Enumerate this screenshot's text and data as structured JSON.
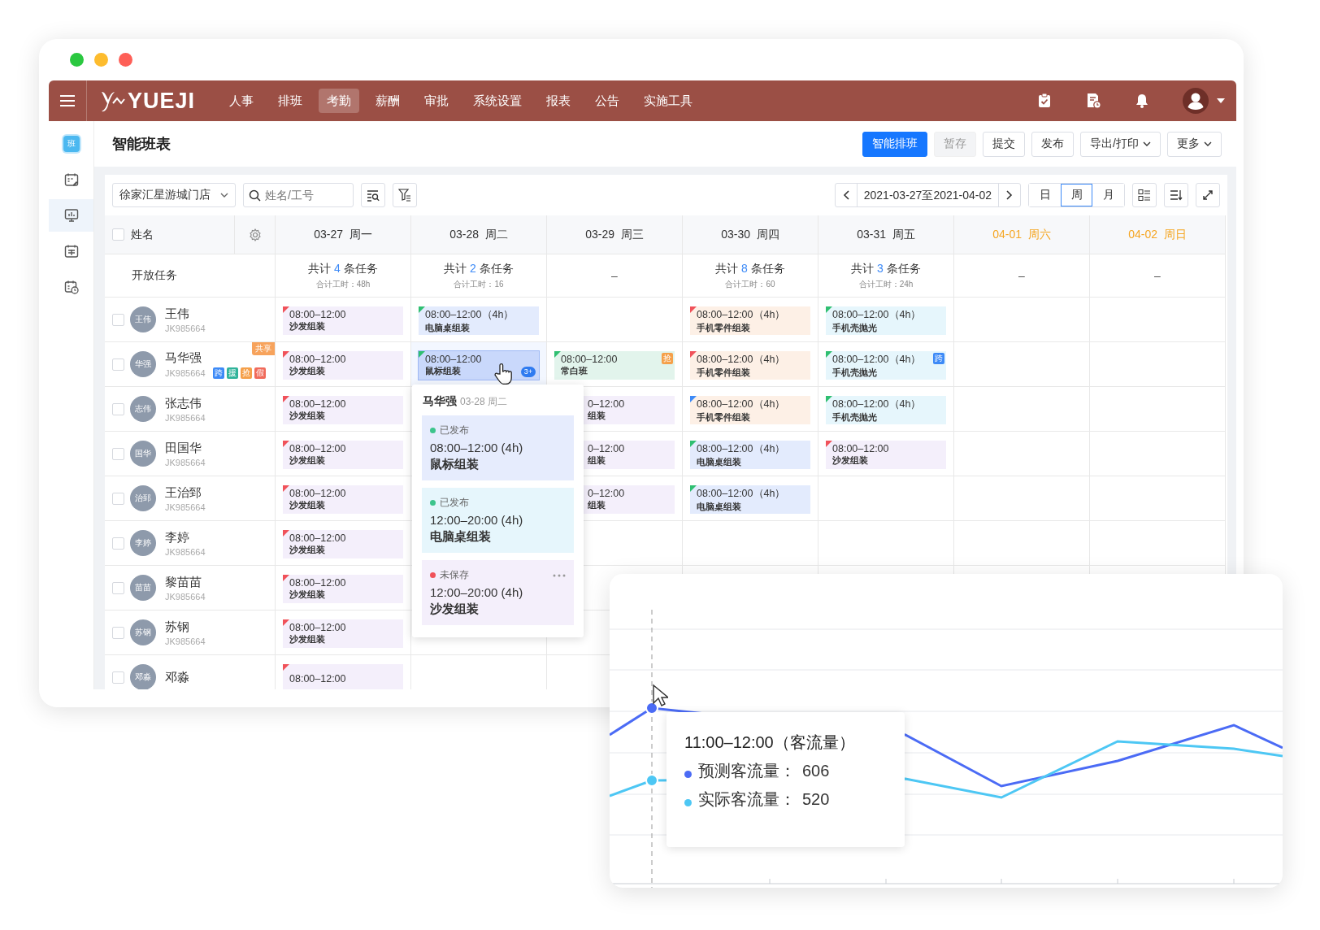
{
  "window_controls": [
    {
      "color": "#2bc840"
    },
    {
      "color": "#fdbc2e"
    },
    {
      "color": "#fe5f57"
    }
  ],
  "nav": {
    "logo": "YUEJI",
    "items": [
      {
        "label": "人事",
        "selected": false
      },
      {
        "label": "排班",
        "selected": false
      },
      {
        "label": "考勤",
        "selected": true
      },
      {
        "label": "薪酬",
        "selected": false
      },
      {
        "label": "审批",
        "selected": false
      },
      {
        "label": "系统设置",
        "selected": false
      },
      {
        "label": "报表",
        "selected": false
      },
      {
        "label": "公告",
        "selected": false
      },
      {
        "label": "实施工具",
        "selected": false
      }
    ]
  },
  "sidebar": [
    {
      "kind": "schedule",
      "text": "班",
      "selected": false
    },
    {
      "kind": "calendar-edit",
      "selected": false
    },
    {
      "kind": "monitor",
      "selected": true
    },
    {
      "kind": "calendar-grid",
      "selected": false
    },
    {
      "kind": "calendar-clock",
      "selected": false
    }
  ],
  "page": {
    "title": "智能班表",
    "actions": [
      {
        "label": "智能排班",
        "kind": "primary",
        "disabled": false,
        "dropdown": false
      },
      {
        "label": "暂存",
        "kind": "default",
        "disabled": true,
        "dropdown": false
      },
      {
        "label": "提交",
        "kind": "default",
        "disabled": false,
        "dropdown": false
      },
      {
        "label": "发布",
        "kind": "default",
        "disabled": false,
        "dropdown": false
      },
      {
        "label": "导出/打印",
        "kind": "default",
        "disabled": false,
        "dropdown": true
      },
      {
        "label": "更多",
        "kind": "default",
        "disabled": false,
        "dropdown": true
      }
    ]
  },
  "filters": {
    "store": "徐家汇星游城门店",
    "search": {
      "placeholder": "姓名/工号"
    },
    "date_range": "2021-03-27至2021-04-02",
    "views": [
      {
        "label": "日",
        "selected": false
      },
      {
        "label": "周",
        "selected": true
      },
      {
        "label": "月",
        "selected": false
      }
    ]
  },
  "table": {
    "name_header": "姓名",
    "all_checked": false,
    "open_label": "开放任务",
    "days": [
      {
        "date": "03-27",
        "weekday": "周一",
        "weekend": false,
        "summary": {
          "kind": "count",
          "prefix": "共计",
          "count": "4",
          "suffix": "条任务",
          "hours": "合计工时：48h"
        }
      },
      {
        "date": "03-28",
        "weekday": "周二",
        "weekend": false,
        "summary": {
          "kind": "count",
          "prefix": "共计",
          "count": "2",
          "suffix": "条任务",
          "hours": "合计工时：16"
        }
      },
      {
        "date": "03-29",
        "weekday": "周三",
        "weekend": false,
        "summary": {
          "kind": "none",
          "text": "–"
        }
      },
      {
        "date": "03-30",
        "weekday": "周四",
        "weekend": false,
        "summary": {
          "kind": "count",
          "prefix": "共计",
          "count": "8",
          "suffix": "条任务",
          "hours": "合计工时：60"
        }
      },
      {
        "date": "03-31",
        "weekday": "周五",
        "weekend": false,
        "summary": {
          "kind": "count",
          "prefix": "共计",
          "count": "3",
          "suffix": "条任务",
          "hours": "合计工时：24h"
        }
      },
      {
        "date": "04-01",
        "weekday": "周六",
        "weekend": true,
        "summary": {
          "kind": "none",
          "text": "–"
        }
      },
      {
        "date": "04-02",
        "weekday": "周日",
        "weekend": true,
        "summary": {
          "kind": "none",
          "text": "–"
        }
      }
    ],
    "rows": [
      {
        "name": "王伟",
        "initials": "王伟",
        "id": "JK985664",
        "checked": false,
        "badges": [],
        "shifts": [
          {
            "kind": "shift",
            "time": "08:00–12:00",
            "job": "沙发组装",
            "color": "#f4effb",
            "flag": {
              "color": "#f0525a"
            },
            "selected": false,
            "clipped": false
          },
          {
            "kind": "shift",
            "time": "08:00–12:00（4h）",
            "job": "电脑桌组装",
            "color": "#e3ebfd",
            "flag": {
              "color": "#2fbf71"
            },
            "selected": false,
            "clipped": false
          },
          {
            "kind": "empty"
          },
          {
            "kind": "shift",
            "time": "08:00–12:00（4h）",
            "job": "手机零件组装",
            "color": "#fdf0e6",
            "flag": {
              "color": "#f0525a"
            },
            "selected": false,
            "clipped": false
          },
          {
            "kind": "shift",
            "time": "08:00–12:00（4h）",
            "job": "手机壳抛光",
            "color": "#e6f6fc",
            "flag": {
              "color": "#2fbf71"
            },
            "selected": false,
            "clipped": false
          },
          {
            "kind": "empty"
          },
          {
            "kind": "empty"
          }
        ]
      },
      {
        "name": "马华强",
        "initials": "华强",
        "id": "JK985664",
        "checked": false,
        "tag": "共享",
        "badges": [
          {
            "text": "跨",
            "color": "#3d8af7"
          },
          {
            "text": "援",
            "color": "#2fb39a"
          },
          {
            "text": "抢",
            "color": "#f5a04a"
          },
          {
            "text": "假",
            "color": "#f06a5a"
          }
        ],
        "shifts": [
          {
            "kind": "shift",
            "time": "08:00–12:00",
            "job": "沙发组装",
            "color": "#f4effb",
            "flag": {
              "color": "#f0525a"
            },
            "selected": false,
            "clipped": false
          },
          {
            "kind": "shift",
            "time": "08:00–12:00",
            "job": "鼠标组装",
            "color": "#c9d8fb",
            "flag": {
              "color": "#2fbf71"
            },
            "selected": true,
            "clipped": false,
            "count": "3+"
          },
          {
            "kind": "shift",
            "time": "08:00–12:00",
            "job": "常白班",
            "color": "#e2f4ec",
            "flag": {
              "color": "#2fbf71"
            },
            "selected": false,
            "clipped": false,
            "tag": {
              "text": "抢",
              "color": "#f5a04a"
            }
          },
          {
            "kind": "shift",
            "time": "08:00–12:00（4h）",
            "job": "手机零件组装",
            "color": "#fdf0e6",
            "flag": {
              "color": "#f0525a"
            },
            "selected": false,
            "clipped": false
          },
          {
            "kind": "shift",
            "time": "08:00–12:00（4h）",
            "job": "手机壳抛光",
            "color": "#e6f6fc",
            "flag": {
              "color": "#2fbf71"
            },
            "selected": false,
            "clipped": false,
            "tag": {
              "text": "跨",
              "color": "#3d8af7"
            }
          },
          {
            "kind": "empty"
          },
          {
            "kind": "empty"
          }
        ]
      },
      {
        "name": "张志伟",
        "initials": "志伟",
        "id": "JK985664",
        "checked": false,
        "badges": [],
        "shifts": [
          {
            "kind": "shift",
            "time": "08:00–12:00",
            "job": "沙发组装",
            "color": "#f4effb",
            "flag": {
              "color": "#f0525a"
            },
            "selected": false,
            "clipped": false
          },
          {
            "kind": "empty"
          },
          {
            "kind": "shift",
            "time": "0–12:00",
            "job": "组装",
            "color": "#f4effb",
            "selected": false,
            "clipped": true
          },
          {
            "kind": "shift",
            "time": "08:00–12:00（4h）",
            "job": "手机零件组装",
            "color": "#fdf0e6",
            "flag": {
              "color": "#3d8af7"
            },
            "selected": false,
            "clipped": false
          },
          {
            "kind": "shift",
            "time": "08:00–12:00（4h）",
            "job": "手机壳抛光",
            "color": "#e6f6fc",
            "flag": {
              "color": "#2fbf71"
            },
            "selected": false,
            "clipped": false
          },
          {
            "kind": "empty"
          },
          {
            "kind": "empty"
          }
        ]
      },
      {
        "name": "田国华",
        "initials": "国华",
        "id": "JK985664",
        "checked": false,
        "badges": [],
        "shifts": [
          {
            "kind": "shift",
            "time": "08:00–12:00",
            "job": "沙发组装",
            "color": "#f4effb",
            "flag": {
              "color": "#f0525a"
            },
            "selected": false,
            "clipped": false
          },
          {
            "kind": "empty"
          },
          {
            "kind": "shift",
            "time": "0–12:00",
            "job": "组装",
            "color": "#f4effb",
            "selected": false,
            "clipped": true
          },
          {
            "kind": "shift",
            "time": "08:00–12:00（4h）",
            "job": "电脑桌组装",
            "color": "#e3ebfd",
            "flag": {
              "color": "#2fbf71"
            },
            "selected": false,
            "clipped": false
          },
          {
            "kind": "shift",
            "time": "08:00–12:00",
            "job": "沙发组装",
            "color": "#f4effb",
            "flag": {
              "color": "#f0525a"
            },
            "selected": false,
            "clipped": false
          },
          {
            "kind": "empty"
          },
          {
            "kind": "empty"
          }
        ]
      },
      {
        "name": "王治郅",
        "initials": "治郅",
        "id": "JK985664",
        "checked": false,
        "badges": [],
        "shifts": [
          {
            "kind": "shift",
            "time": "08:00–12:00",
            "job": "沙发组装",
            "color": "#f4effb",
            "flag": {
              "color": "#f0525a"
            },
            "selected": false,
            "clipped": false
          },
          {
            "kind": "empty"
          },
          {
            "kind": "shift",
            "time": "0–12:00",
            "job": "组装",
            "color": "#f4effb",
            "selected": false,
            "clipped": true
          },
          {
            "kind": "shift",
            "time": "08:00–12:00（4h）",
            "job": "电脑桌组装",
            "color": "#e3ebfd",
            "flag": {
              "color": "#2fbf71"
            },
            "selected": false,
            "clipped": false
          },
          {
            "kind": "empty"
          },
          {
            "kind": "empty"
          },
          {
            "kind": "empty"
          }
        ]
      },
      {
        "name": "李婷",
        "initials": "李婷",
        "id": "JK985664",
        "checked": false,
        "badges": [],
        "shifts": [
          {
            "kind": "shift",
            "time": "08:00–12:00",
            "job": "沙发组装",
            "color": "#f4effb",
            "flag": {
              "color": "#f0525a"
            },
            "selected": false,
            "clipped": false
          },
          {
            "kind": "empty"
          },
          {
            "kind": "empty"
          },
          {
            "kind": "empty"
          },
          {
            "kind": "empty"
          },
          {
            "kind": "empty"
          },
          {
            "kind": "empty"
          }
        ]
      },
      {
        "name": "黎苗苗",
        "initials": "苗苗",
        "id": "JK985664",
        "checked": false,
        "badges": [],
        "shifts": [
          {
            "kind": "shift",
            "time": "08:00–12:00",
            "job": "沙发组装",
            "color": "#f4effb",
            "flag": {
              "color": "#f0525a"
            },
            "selected": false,
            "clipped": false
          },
          {
            "kind": "empty"
          },
          {
            "kind": "empty"
          },
          {
            "kind": "empty"
          },
          {
            "kind": "empty"
          },
          {
            "kind": "empty"
          },
          {
            "kind": "empty"
          }
        ]
      },
      {
        "name": "苏钢",
        "initials": "苏钢",
        "id": "JK985664",
        "checked": false,
        "badges": [],
        "shifts": [
          {
            "kind": "shift",
            "time": "08:00–12:00",
            "job": "沙发组装",
            "color": "#f4effb",
            "flag": {
              "color": "#f0525a"
            },
            "selected": false,
            "clipped": false
          },
          {
            "kind": "empty"
          },
          {
            "kind": "empty"
          },
          {
            "kind": "empty"
          },
          {
            "kind": "empty"
          },
          {
            "kind": "empty"
          },
          {
            "kind": "empty"
          }
        ]
      },
      {
        "name": "邓淼",
        "initials": "邓淼",
        "checked": false,
        "badges": [],
        "shifts": [
          {
            "kind": "shift",
            "time": "08:00–12:00",
            "color": "#f4effb",
            "flag": {
              "color": "#f0525a"
            },
            "selected": false,
            "clipped": false
          },
          {
            "kind": "empty"
          },
          {
            "kind": "empty"
          },
          {
            "kind": "empty"
          },
          {
            "kind": "empty"
          },
          {
            "kind": "empty"
          },
          {
            "kind": "empty"
          }
        ]
      }
    ]
  },
  "popover": {
    "name": "马华强",
    "date": "03-28 周二",
    "items": [
      {
        "status": {
          "text": "已发布",
          "color": "#3cc48c"
        },
        "color": "#e6ecfd",
        "time": "08:00–12:00 (4h)",
        "job": "鼠标组装",
        "more": false
      },
      {
        "status": {
          "text": "已发布",
          "color": "#3cc48c"
        },
        "color": "#e6f6fc",
        "time": "12:00–20:00 (4h)",
        "job": "电脑桌组装",
        "more": false
      },
      {
        "status": {
          "text": "未保存",
          "color": "#f0525a"
        },
        "color": "#f4effb",
        "time": "12:00–20:00 (4h)",
        "job": "沙发组装",
        "more": true
      }
    ]
  },
  "chart": {
    "tooltip": {
      "title": "11:00–12:00（客流量）",
      "rows": [
        {
          "label": "预测客流量：",
          "value": "606",
          "color": "#4b6bf5"
        },
        {
          "label": "实际客流量：",
          "value": "520",
          "color": "#4dc7f4"
        }
      ]
    }
  }
}
